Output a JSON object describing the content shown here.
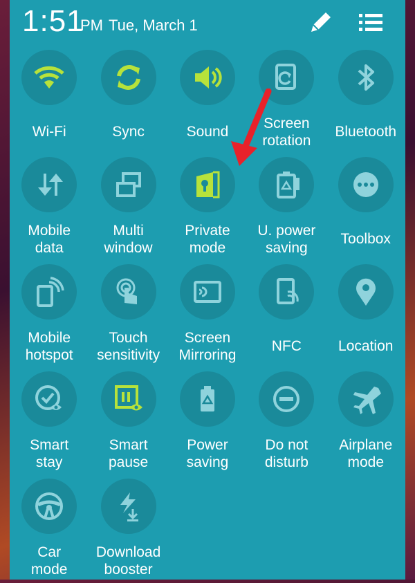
{
  "status": {
    "time": "1:51",
    "ampm": "PM",
    "date": "Tue, March 1"
  },
  "colors": {
    "panel": "#1d9db0",
    "icon_active": "#b7e23b",
    "icon_inactive": "#8fd3dc",
    "arrow": "#e8222a"
  },
  "tiles": [
    {
      "label": "Wi-Fi",
      "icon": "wifi-icon",
      "active": true
    },
    {
      "label": "Sync",
      "icon": "sync-icon",
      "active": true
    },
    {
      "label": "Sound",
      "icon": "sound-icon",
      "active": true
    },
    {
      "label": "Screen\nrotation",
      "icon": "screen-rotation-icon",
      "active": false
    },
    {
      "label": "Bluetooth",
      "icon": "bluetooth-icon",
      "active": false
    },
    {
      "label": "Mobile\ndata",
      "icon": "mobile-data-icon",
      "active": false
    },
    {
      "label": "Multi\nwindow",
      "icon": "multi-window-icon",
      "active": false
    },
    {
      "label": "Private\nmode",
      "icon": "private-mode-icon",
      "active": true
    },
    {
      "label": "U. power\nsaving",
      "icon": "ultra-power-saving-icon",
      "active": false
    },
    {
      "label": "Toolbox",
      "icon": "toolbox-icon",
      "active": false
    },
    {
      "label": "Mobile\nhotspot",
      "icon": "mobile-hotspot-icon",
      "active": false
    },
    {
      "label": "Touch\nsensitivity",
      "icon": "touch-sensitivity-icon",
      "active": false
    },
    {
      "label": "Screen\nMirroring",
      "icon": "screen-mirroring-icon",
      "active": false
    },
    {
      "label": "NFC",
      "icon": "nfc-icon",
      "active": false
    },
    {
      "label": "Location",
      "icon": "location-icon",
      "active": false
    },
    {
      "label": "Smart\nstay",
      "icon": "smart-stay-icon",
      "active": false
    },
    {
      "label": "Smart\npause",
      "icon": "smart-pause-icon",
      "active": true
    },
    {
      "label": "Power\nsaving",
      "icon": "power-saving-icon",
      "active": false
    },
    {
      "label": "Do not\ndisturb",
      "icon": "do-not-disturb-icon",
      "active": false
    },
    {
      "label": "Airplane\nmode",
      "icon": "airplane-icon",
      "active": false
    },
    {
      "label": "Car\nmode",
      "icon": "car-mode-icon",
      "active": false
    },
    {
      "label": "Download\nbooster",
      "icon": "download-booster-icon",
      "active": false
    }
  ]
}
